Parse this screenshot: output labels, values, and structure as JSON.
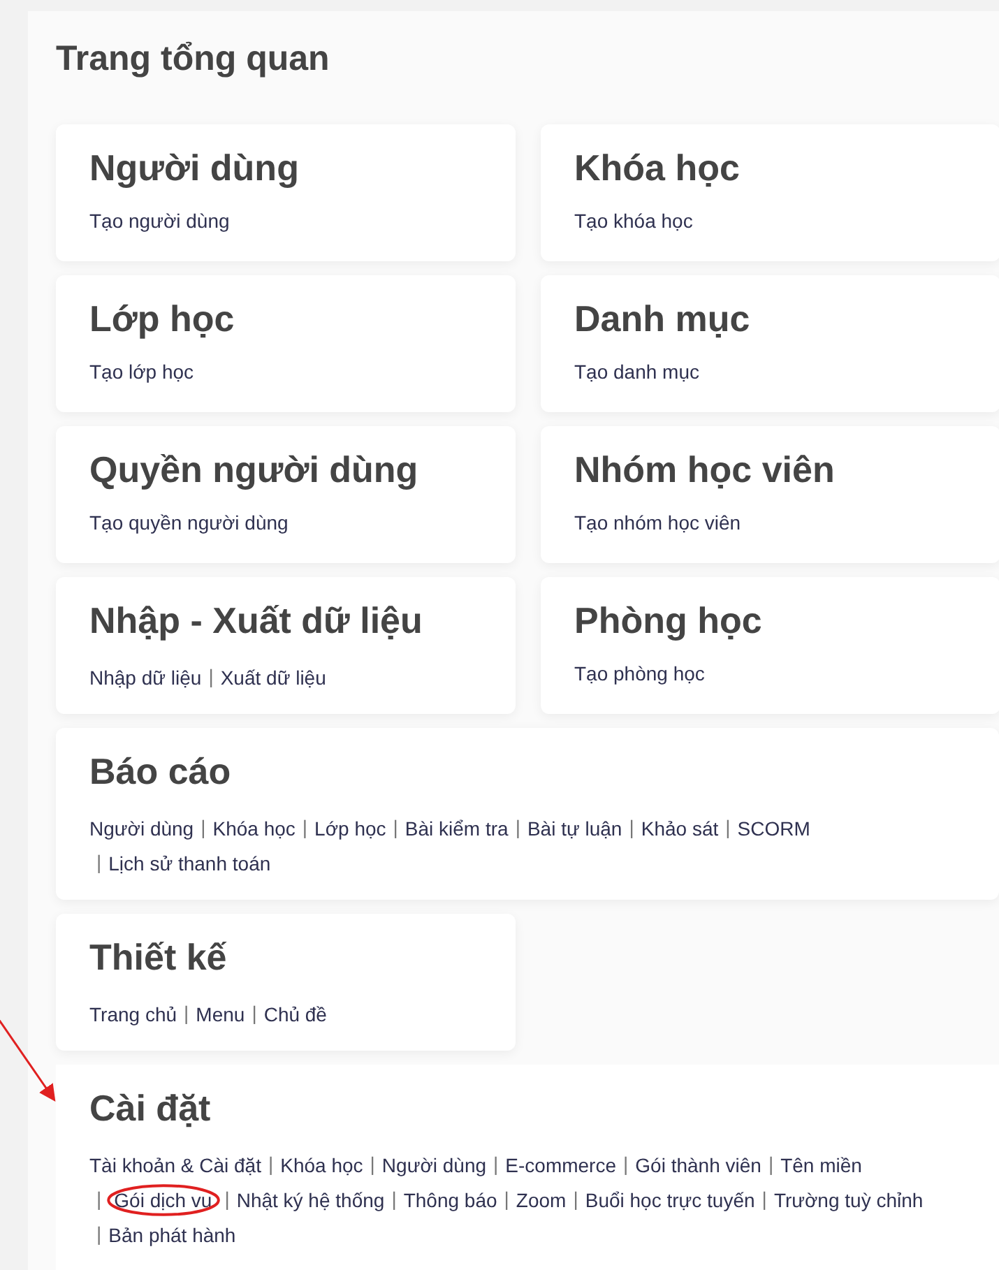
{
  "page_title": "Trang tổng quan",
  "link_separator": "|",
  "cards": [
    {
      "kind": "half",
      "title": "Người dùng",
      "links": [
        {
          "label": "Tạo người dùng",
          "circled": false
        }
      ]
    },
    {
      "kind": "half",
      "title": "Khóa học",
      "links": [
        {
          "label": "Tạo khóa học",
          "circled": false
        }
      ]
    },
    {
      "kind": "half",
      "title": "Lớp học",
      "links": [
        {
          "label": "Tạo lớp học",
          "circled": false
        }
      ]
    },
    {
      "kind": "half",
      "title": "Danh mục",
      "links": [
        {
          "label": "Tạo danh mục",
          "circled": false
        }
      ]
    },
    {
      "kind": "half",
      "title": "Quyền người dùng",
      "links": [
        {
          "label": "Tạo quyền người dùng",
          "circled": false
        }
      ]
    },
    {
      "kind": "half",
      "title": "Nhóm học viên",
      "links": [
        {
          "label": "Tạo nhóm học viên",
          "circled": false
        }
      ]
    },
    {
      "kind": "half",
      "title": "Nhập - Xuất dữ liệu",
      "links": [
        {
          "label": "Nhập dữ liệu",
          "circled": false
        },
        {
          "label": "Xuất dữ liệu",
          "circled": false
        }
      ]
    },
    {
      "kind": "half",
      "title": "Phòng học",
      "links": [
        {
          "label": "Tạo phòng học",
          "circled": false
        }
      ]
    },
    {
      "kind": "wide",
      "title": "Báo cáo",
      "pointed": false,
      "links": [
        {
          "label": "Người dùng",
          "circled": false
        },
        {
          "label": "Khóa học",
          "circled": false
        },
        {
          "label": "Lớp học",
          "circled": false
        },
        {
          "label": "Bài kiểm tra",
          "circled": false
        },
        {
          "label": "Bài tự luận",
          "circled": false
        },
        {
          "label": "Khảo sát",
          "circled": false
        },
        {
          "label": "SCORM",
          "circled": false
        },
        {
          "label": "Lịch sử thanh toán",
          "circled": false
        }
      ]
    },
    {
      "kind": "half",
      "title": "Thiết kế",
      "links": [
        {
          "label": "Trang chủ",
          "circled": false
        },
        {
          "label": "Menu",
          "circled": false
        },
        {
          "label": "Chủ đề",
          "circled": false
        }
      ]
    },
    {
      "kind": "open",
      "title": "Cài đặt",
      "pointed": true,
      "links": [
        {
          "label": "Tài khoản & Cài đặt",
          "circled": false
        },
        {
          "label": "Khóa học",
          "circled": false
        },
        {
          "label": "Người dùng",
          "circled": false
        },
        {
          "label": "E-commerce",
          "circled": false
        },
        {
          "label": "Gói thành viên",
          "circled": false
        },
        {
          "label": "Tên miền",
          "circled": false
        },
        {
          "label": "Gói dịch vụ",
          "circled": true
        },
        {
          "label": "Nhật ký hệ thống",
          "circled": false
        },
        {
          "label": "Thông báo",
          "circled": false
        },
        {
          "label": "Zoom",
          "circled": false
        },
        {
          "label": "Buổi học trực tuyến",
          "circled": false
        },
        {
          "label": "Trường tuỳ chỉnh",
          "circled": false
        },
        {
          "label": "Bản phát hành",
          "circled": false
        }
      ]
    }
  ]
}
